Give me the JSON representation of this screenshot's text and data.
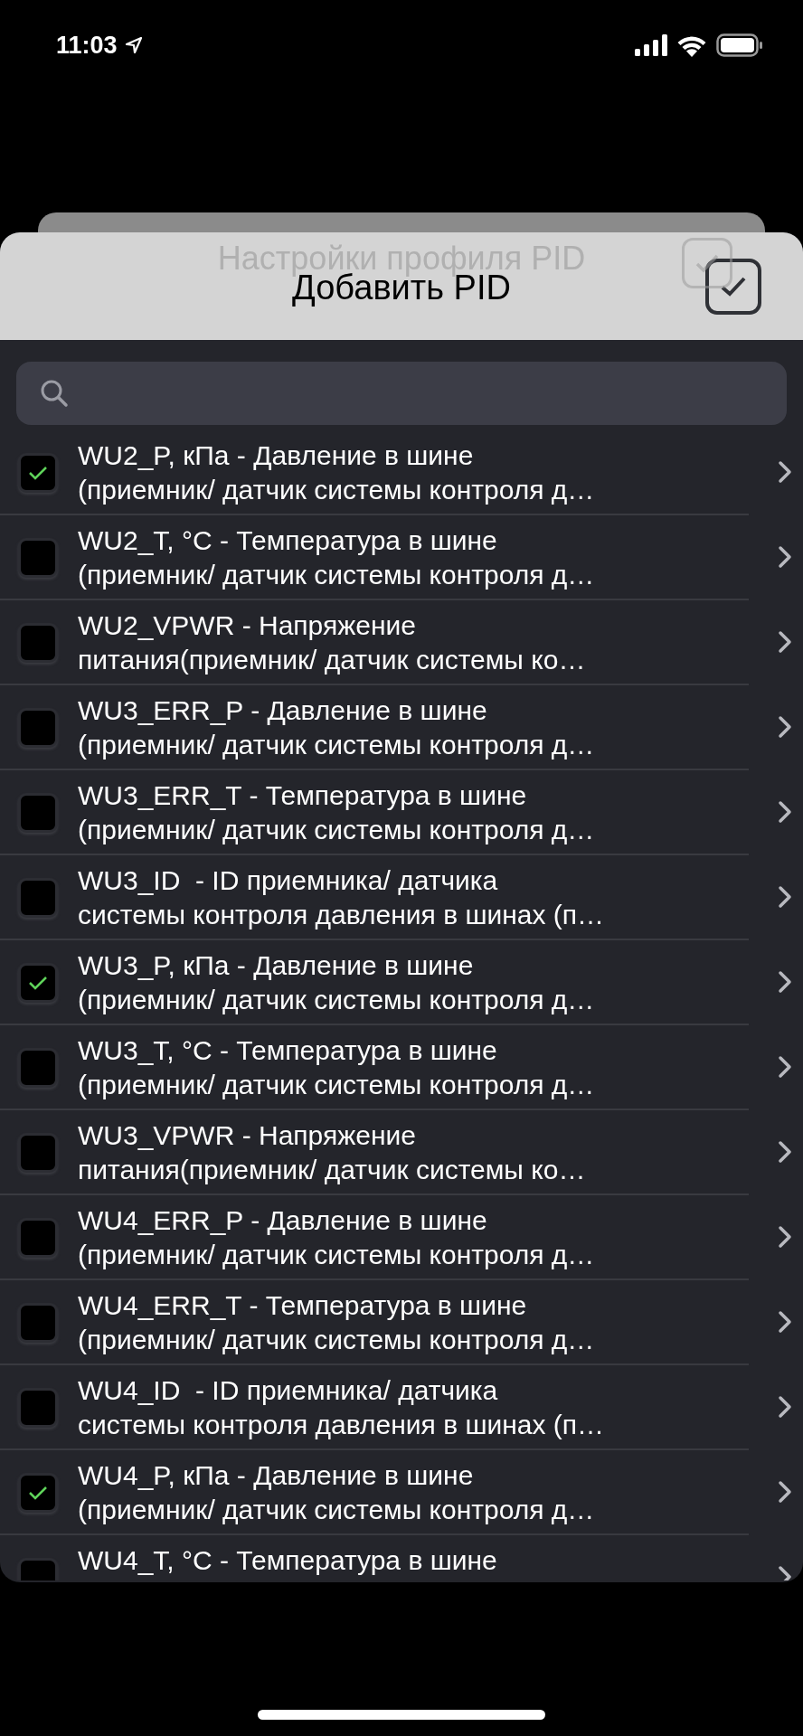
{
  "status_bar": {
    "time": "11:03"
  },
  "back_sheet": {
    "title": "Настройки профиля PID"
  },
  "sheet": {
    "title": "Добавить PID"
  },
  "items": [
    {
      "lines": [
        "WU2_P, кПа - Давление в шине",
        "(приемник/ датчик системы контроля д…"
      ],
      "checked": true
    },
    {
      "lines": [
        "WU2_T, °C - Температура в шине",
        "(приемник/ датчик системы контроля д…"
      ],
      "checked": false
    },
    {
      "lines": [
        "WU2_VPWR - Напряжение",
        "питания(приемник/ датчик системы ко…"
      ],
      "checked": false
    },
    {
      "lines": [
        "WU3_ERR_P - Давление в шине",
        "(приемник/ датчик системы контроля д…"
      ],
      "checked": false
    },
    {
      "lines": [
        "WU3_ERR_T - Температура в шине",
        "(приемник/ датчик системы контроля д…"
      ],
      "checked": false
    },
    {
      "lines": [
        "WU3_ID  - ID приемника/ датчика",
        "системы контроля давления в шинах (п…"
      ],
      "checked": false
    },
    {
      "lines": [
        "WU3_P, кПа - Давление в шине",
        "(приемник/ датчик системы контроля д…"
      ],
      "checked": true
    },
    {
      "lines": [
        "WU3_T, °C - Температура в шине",
        "(приемник/ датчик системы контроля д…"
      ],
      "checked": false
    },
    {
      "lines": [
        "WU3_VPWR - Напряжение",
        "питания(приемник/ датчик системы ко…"
      ],
      "checked": false
    },
    {
      "lines": [
        "WU4_ERR_P - Давление в шине",
        "(приемник/ датчик системы контроля д…"
      ],
      "checked": false
    },
    {
      "lines": [
        "WU4_ERR_T - Температура в шине",
        "(приемник/ датчик системы контроля д…"
      ],
      "checked": false
    },
    {
      "lines": [
        "WU4_ID  - ID приемника/ датчика",
        "системы контроля давления в шинах (п…"
      ],
      "checked": false
    },
    {
      "lines": [
        "WU4_P, кПа - Давление в шине",
        "(приемник/ датчик системы контроля д…"
      ],
      "checked": true
    },
    {
      "lines": [
        "WU4_T, °C - Температура в шине"
      ],
      "checked": false
    }
  ]
}
